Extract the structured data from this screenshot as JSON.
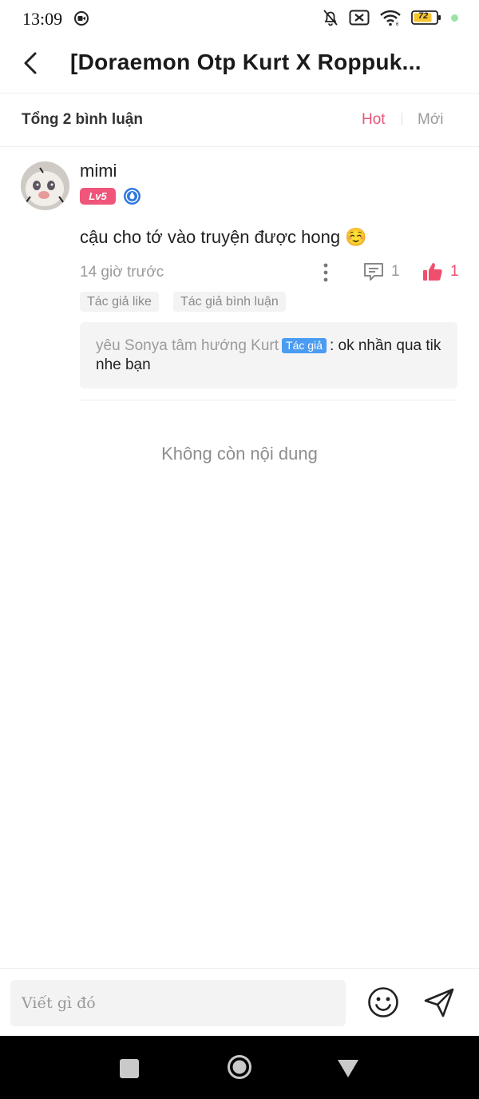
{
  "status_bar": {
    "time": "13:09",
    "battery_level": "72",
    "icons": [
      "screen-record-icon",
      "bell-off-icon",
      "no-sim-icon",
      "wifi-icon",
      "battery-icon",
      "notification-dot-icon"
    ]
  },
  "header": {
    "title": "[Doraemon Otp Kurt X Roppuk..."
  },
  "summary": {
    "total_label": "Tổng 2 bình luận",
    "sort_hot": "Hot",
    "sort_new": "Mới",
    "active_sort_color": "#e8557a"
  },
  "comment": {
    "username": "mimi",
    "level": "Lv5",
    "text": "cậu cho tớ vào truyện được hong ☺️",
    "time": "14 giờ trước",
    "reply_count": "1",
    "like_count": "1",
    "tags": [
      "Tác giả like",
      "Tác giả bình luận"
    ],
    "reply": {
      "user": "yêu Sonya tâm hướng Kurt",
      "badge": "Tác giả",
      "text": ": ok nhần qua tik nhe bạn"
    }
  },
  "end_message": "Không còn nội dung",
  "input": {
    "placeholder": "Viết gì đó"
  },
  "colors": {
    "accent_pink": "#f0557a",
    "like_red": "#ef4f6c",
    "author_blue": "#4a9cf2"
  }
}
